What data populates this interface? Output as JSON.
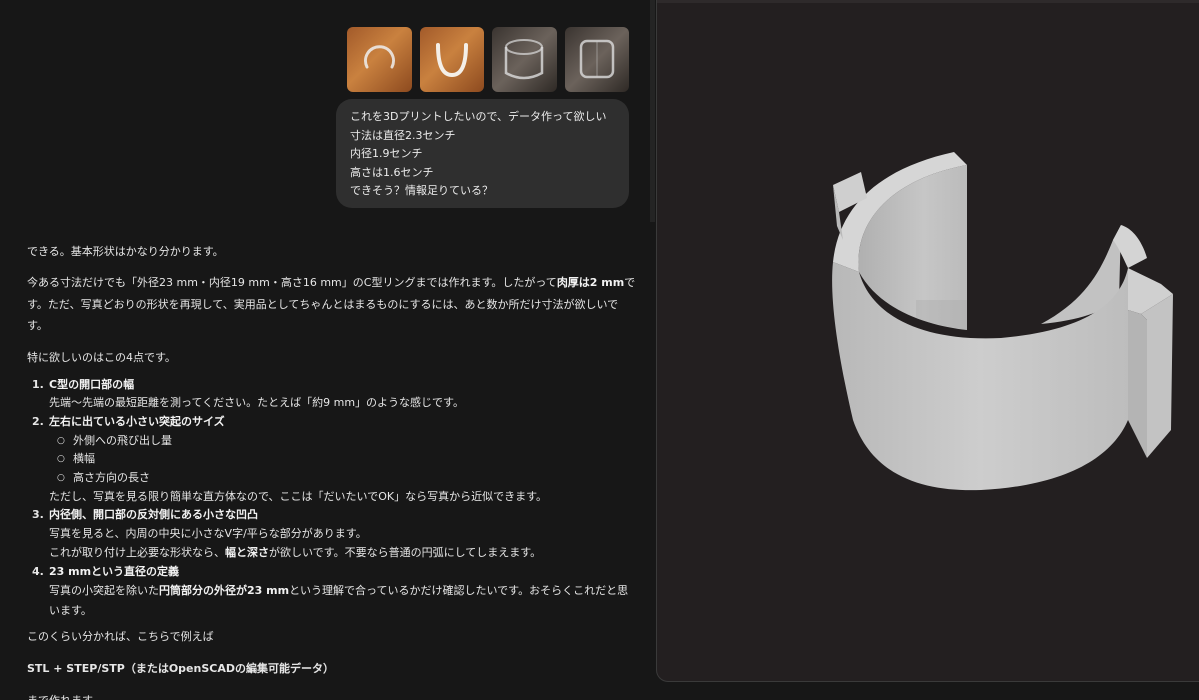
{
  "user_message": {
    "images": [
      {
        "name": "photo-1-top-view",
        "style": "wood"
      },
      {
        "name": "photo-2-side-view",
        "style": "wood"
      },
      {
        "name": "photo-3-angle-view",
        "style": "gray"
      },
      {
        "name": "photo-4-front-view",
        "style": "gray"
      }
    ],
    "lines": [
      "これを3Dプリントしたいので、データ作って欲しい",
      "寸法は直径2.3センチ",
      "内径1.9センチ",
      "高さは1.6センチ",
      "できそう？情報足りている？"
    ]
  },
  "assistant_message": {
    "p1": "できる。基本形状はかなり分かります。",
    "p2": {
      "a": "今ある寸法だけでも「外径23 mm・内径19 mm・高さ16 mm」のC型リングまでは作れます。したがって",
      "bold": "肉厚は2 mm",
      "b": "です。ただ、写真どおりの形状を再現して、実用品としてちゃんとはまるものにするには、あと数か所だけ寸法が欲しいです。"
    },
    "p3": "特に欲しいのはこの4点です。",
    "items": [
      {
        "num": "1.",
        "title": "C型の開口部の幅",
        "line1": "先端〜先端の最短距離を測ってください。たとえば「約9 mm」のような感じです。"
      },
      {
        "num": "2.",
        "title": "左右に出ている小さい突起のサイズ",
        "subs": [
          "外側への飛び出し量",
          "横幅",
          "高さ方向の長さ"
        ],
        "note": "ただし、写真を見る限り簡単な直方体なので、ここは「だいたいでOK」なら写真から近似できます。"
      },
      {
        "num": "3.",
        "title": "内径側、開口部の反対側にある小さな凹凸",
        "line1": "写真を見ると、内周の中央に小さなV字/平らな部分があります。",
        "line2_a": "これが取り付け上必要な形状なら、",
        "line2_bold": "幅と深さ",
        "line2_b": "が欲しいです。不要なら普通の円弧にしてしまえます。"
      },
      {
        "num": "4.",
        "title": "23 mmという直径の定義",
        "line1_a": "写真の小突起を除いた",
        "line1_bold": "円筒部分の外径が23 mm",
        "line1_b": "という理解で合っているかだけ確認したいです。おそらくこれだと思います。"
      }
    ],
    "p_close": "このくらい分かれば、こちらで例えば",
    "p_format": "STL + STEP/STP（またはOpenSCADの編集可能データ）",
    "p_tail": "まで作れます。"
  },
  "viewer": {
    "background": "#231f20",
    "model": "c-shaped-ring-with-tabs",
    "model_color": "#c4c4c4"
  }
}
